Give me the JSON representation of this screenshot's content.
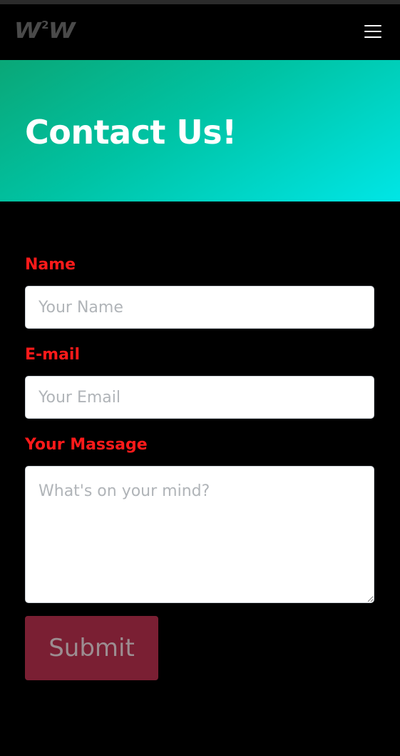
{
  "navbar": {
    "logo_main": "W",
    "logo_sup": "2",
    "logo_end": "W",
    "menu_icon": "hamburger-menu-icon"
  },
  "hero": {
    "title": "Contact Us!"
  },
  "form": {
    "name_label": "Name",
    "name_placeholder": "Your Name",
    "email_label": "E-mail",
    "email_placeholder": "Your Email",
    "message_label": "Your Massage",
    "message_placeholder": "What's on your mind?",
    "submit_label": "Submit"
  },
  "colors": {
    "label": "#ff1a1a",
    "submit_bg": "#7a1f33",
    "hero_gradient_start": "#0aa777",
    "hero_gradient_end": "#00e6e6"
  }
}
